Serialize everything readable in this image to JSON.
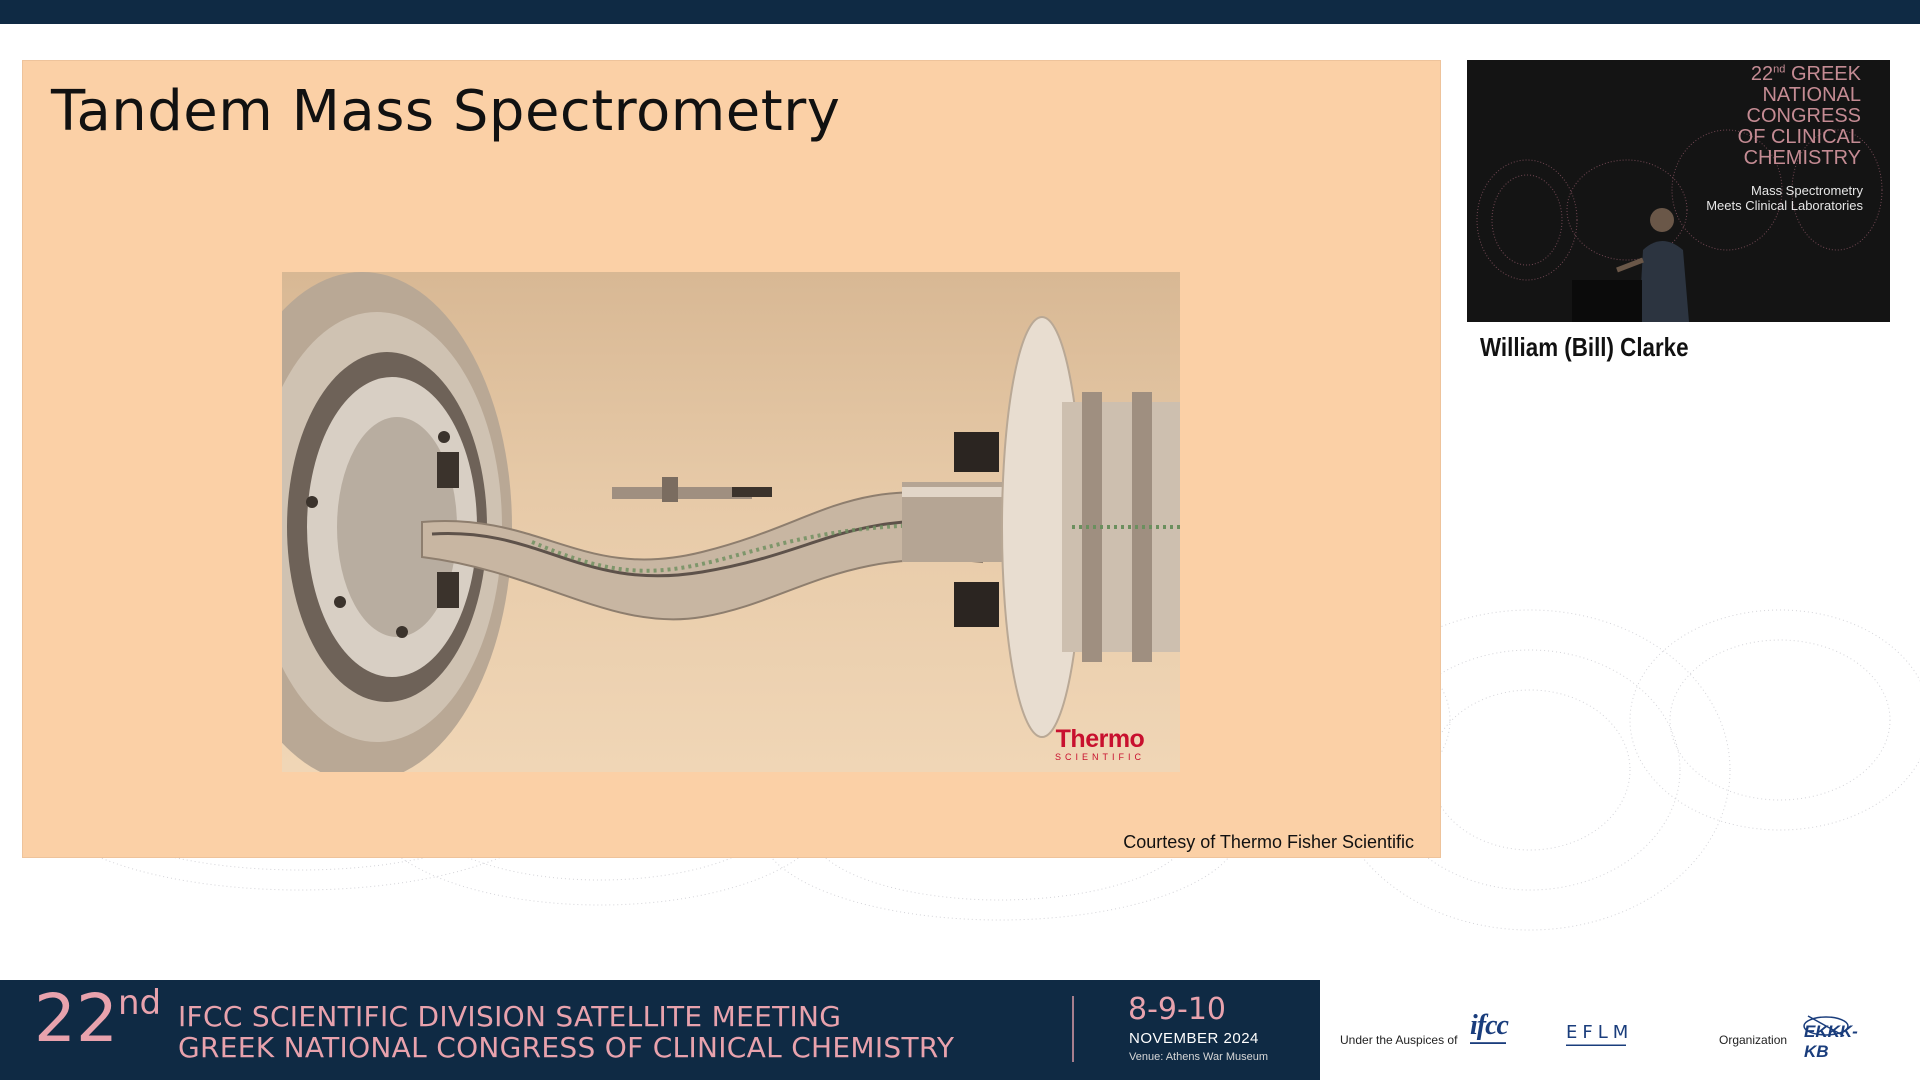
{
  "slide": {
    "title": "Tandem Mass Spectrometry",
    "caption": "Courtesy of Thermo Fisher Scientific",
    "figure_logo": {
      "name": "Thermo",
      "sub": "SCIENTIFIC"
    }
  },
  "speaker": {
    "video_header": {
      "ordinal_number": "22",
      "ordinal_suffix": "nd",
      "line1": "GREEK",
      "line2": "NATIONAL",
      "line3": "CONGRESS",
      "line4": "OF CLINICAL",
      "line5": "CHEMISTRY"
    },
    "video_tagline": {
      "line1": "Mass Spectrometry",
      "line2": "Meets Clinical Laboratories"
    },
    "name": "William (Bill) Clarke"
  },
  "banner": {
    "number": "22",
    "number_suffix": "nd",
    "line1": "IFCC SCIENTIFIC DIVISION SATELLITE MEETING",
    "line2": "GREEK NATIONAL CONGRESS OF CLINICAL CHEMISTRY",
    "dates": "8-9-10",
    "month": "NOVEMBER 2024",
    "venue": "Venue: Athens War Museum"
  },
  "sponsors": {
    "auspices_label": "Under the Auspices of",
    "organization_label": "Organization",
    "logos": [
      {
        "name": "IFCC",
        "text": "ifcc"
      },
      {
        "name": "EFLM",
        "text": "EFLM"
      },
      {
        "name": "EKKK-KB",
        "text": "EKKK-KB"
      }
    ]
  },
  "colors": {
    "banner_background": "#0f2a44",
    "banner_accent": "#e8a2ad",
    "slide_background": "#fbd0a6",
    "thermo_red": "#c8102e"
  }
}
